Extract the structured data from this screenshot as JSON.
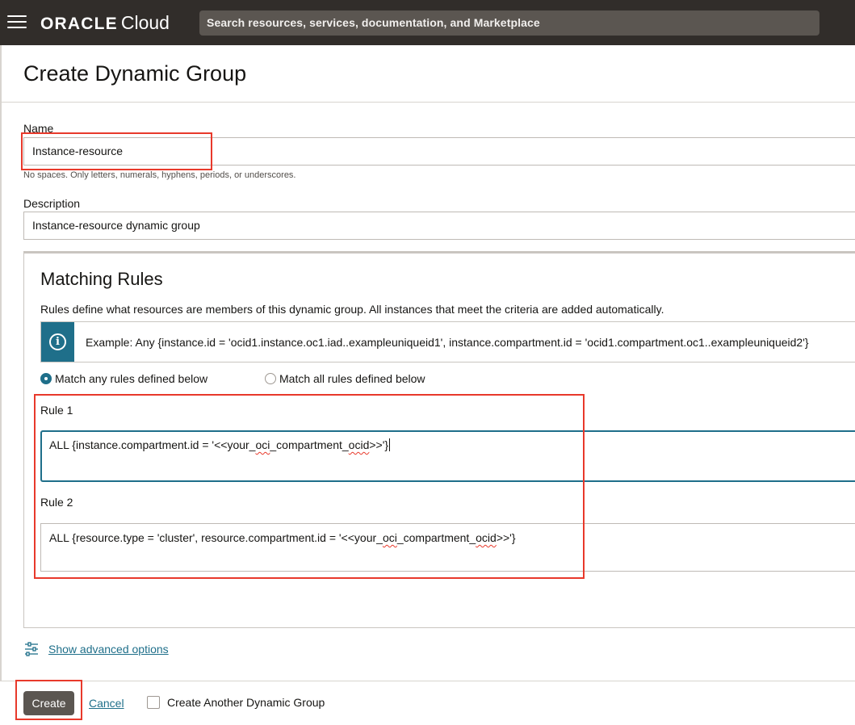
{
  "header": {
    "brand": "ORACLE",
    "brand_product": "Cloud",
    "search_placeholder": "Search resources, services, documentation, and Marketplace"
  },
  "page": {
    "title": "Create Dynamic Group"
  },
  "form": {
    "name_label": "Name",
    "name_value": "Instance-resource",
    "name_hint": "No spaces. Only letters, numerals, hyphens, periods, or underscores.",
    "description_label": "Description",
    "description_value": "Instance-resource dynamic group"
  },
  "matching_rules": {
    "title": "Matching Rules",
    "description": "Rules define what resources are members of this dynamic group. All instances that meet the criteria are added automatically.",
    "info_example": "Example: Any {instance.id = 'ocid1.instance.oc1.iad..exampleuniqueid1', instance.compartment.id = 'ocid1.compartment.oc1..exampleuniqueid2'}",
    "match_options": [
      {
        "label": "Match any rules defined below",
        "selected": true
      },
      {
        "label": "Match all rules defined below",
        "selected": false
      }
    ],
    "rules": [
      {
        "label": "Rule 1",
        "text_before": "ALL {instance.compartment.id = '<<your_",
        "text_oci": "oci",
        "text_mid": "_compartment_",
        "text_ocid": "ocid",
        "text_after": ">>'}"
      },
      {
        "label": "Rule 2",
        "text_before": "ALL {resource.type = 'cluster', resource.compartment.id = '<<your_",
        "text_oci": "oci",
        "text_mid": "_compartment_",
        "text_ocid": "ocid",
        "text_after": ">>'}"
      }
    ]
  },
  "advanced": {
    "link_label": "Show advanced options"
  },
  "footer": {
    "create_label": "Create",
    "cancel_label": "Cancel",
    "create_another_label": "Create Another Dynamic Group",
    "create_another_checked": false
  },
  "colors": {
    "topbar": "#312d2a",
    "search_bg": "#5b5651",
    "accent": "#1f6f8a",
    "highlight_box": "#e8392b",
    "primary_button": "#5b5651"
  }
}
